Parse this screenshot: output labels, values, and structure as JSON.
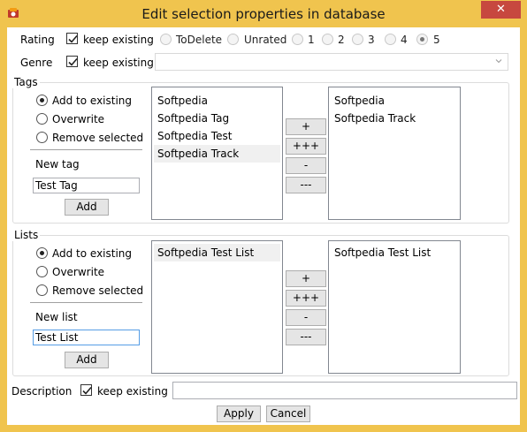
{
  "window": {
    "title": "Edit selection properties in database",
    "close_glyph": "✕",
    "icon": "app-icon",
    "titlebar_color": "#f0c44e",
    "close_color": "#c7483f"
  },
  "rating": {
    "label": "Rating",
    "keep_existing": {
      "label": "keep existing",
      "checked": true
    },
    "options": [
      {
        "label": "ToDelete",
        "selected": false
      },
      {
        "label": "Unrated",
        "selected": false
      },
      {
        "label": "1",
        "selected": false
      },
      {
        "label": "2",
        "selected": false
      },
      {
        "label": "3",
        "selected": false
      },
      {
        "label": "4",
        "selected": false
      },
      {
        "label": "5",
        "selected": true
      }
    ]
  },
  "genre": {
    "label": "Genre",
    "keep_existing": {
      "label": "keep existing",
      "checked": true
    },
    "value": ""
  },
  "tags": {
    "title": "Tags",
    "modes": [
      {
        "label": "Add to existing",
        "selected": true
      },
      {
        "label": "Overwrite",
        "selected": false
      },
      {
        "label": "Remove selected",
        "selected": false
      }
    ],
    "new_label": "New tag",
    "new_value": "Test Tag",
    "add_label": "Add",
    "available": [
      "Softpedia",
      "Softpedia Tag",
      "Softpedia Test",
      "Softpedia Track"
    ],
    "available_selected": "Softpedia Track",
    "move_buttons": [
      "+",
      "+++",
      "-",
      "---"
    ],
    "assigned": [
      "Softpedia",
      "Softpedia Track"
    ]
  },
  "lists": {
    "title": "Lists",
    "modes": [
      {
        "label": "Add to existing",
        "selected": true
      },
      {
        "label": "Overwrite",
        "selected": false
      },
      {
        "label": "Remove selected",
        "selected": false
      }
    ],
    "new_label": "New list",
    "new_value": "Test List",
    "add_label": "Add",
    "available": [
      "Softpedia Test List"
    ],
    "available_selected": "Softpedia Test List",
    "move_buttons": [
      "+",
      "+++",
      "-",
      "---"
    ],
    "assigned": [
      "Softpedia Test List"
    ]
  },
  "description": {
    "label": "Description",
    "keep_existing": {
      "label": "keep existing",
      "checked": true
    },
    "value": ""
  },
  "footer": {
    "apply_label": "Apply",
    "cancel_label": "Cancel"
  }
}
